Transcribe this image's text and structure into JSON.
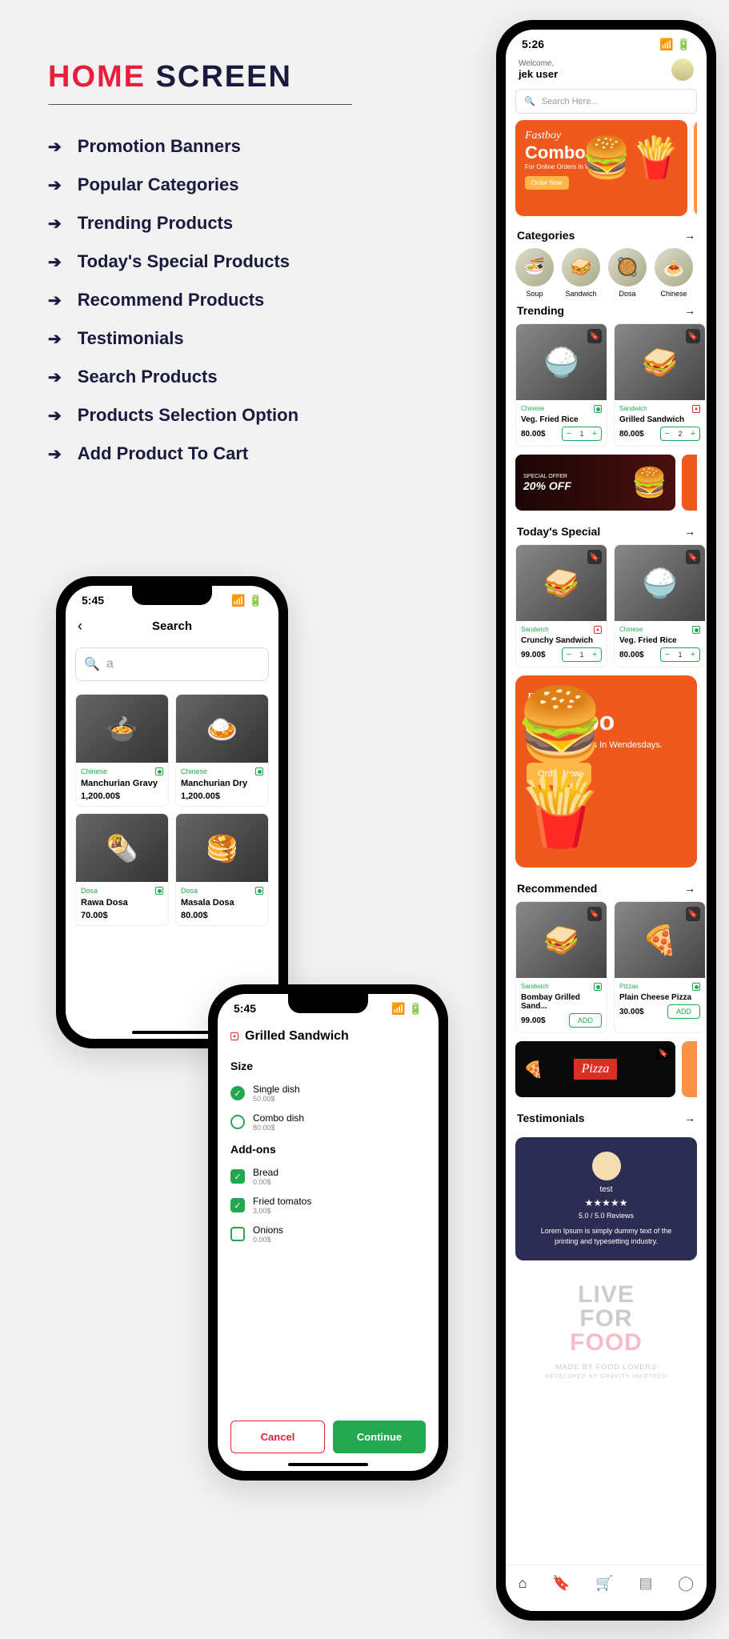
{
  "page": {
    "title_accent": "HOME",
    "title_rest": "SCREEN"
  },
  "features": [
    "Promotion Banners",
    "Popular Categories",
    "Trending Products",
    "Today's Special Products",
    "Recommend Products",
    "Testimonials",
    "Search Products",
    "Products Selection Option",
    "Add Product To Cart"
  ],
  "searchScreen": {
    "time": "5:45",
    "title": "Search",
    "query": "a",
    "products": [
      {
        "cat": "Chinese",
        "name": "Manchurian Gravy",
        "price": "1,200.00$",
        "emoji": "🍲"
      },
      {
        "cat": "Chinese",
        "name": "Manchurian Dry",
        "price": "1,200.00$",
        "emoji": "🍛"
      },
      {
        "cat": "Dosa",
        "name": "Rawa Dosa",
        "price": "70.00$",
        "emoji": "🌯"
      },
      {
        "cat": "Dosa",
        "name": "Masala Dosa",
        "price": "80.00$",
        "emoji": "🥞"
      }
    ]
  },
  "detailScreen": {
    "time": "5:45",
    "title": "Grilled Sandwich",
    "sizeLabel": "Size",
    "sizes": [
      {
        "name": "Single dish",
        "price": "50.00$",
        "selected": true
      },
      {
        "name": "Combo dish",
        "price": "80.00$",
        "selected": false
      }
    ],
    "addonsLabel": "Add-ons",
    "addons": [
      {
        "name": "Bread",
        "price": "0.00$",
        "selected": true
      },
      {
        "name": "Fried tomatos",
        "price": "3.00$",
        "selected": true
      },
      {
        "name": "Onions",
        "price": "0.00$",
        "selected": false
      }
    ],
    "cancel": "Cancel",
    "continue": "Continue"
  },
  "homeScreen": {
    "time": "5:26",
    "welcome": "Welcome,",
    "user": "jek user",
    "searchPlaceholder": "Search Here...",
    "promo": {
      "brand": "Fastboy",
      "combo": "Combo",
      "sub": "For Online Orders In Wendesdays.",
      "btn": "Order Now"
    },
    "catsTitle": "Categories",
    "cats": [
      {
        "name": "Soup",
        "emoji": "🍜"
      },
      {
        "name": "Sandwich",
        "emoji": "🥪"
      },
      {
        "name": "Dosa",
        "emoji": "🥘"
      },
      {
        "name": "Chinese",
        "emoji": "🍝"
      }
    ],
    "trendTitle": "Trending",
    "trending": [
      {
        "cat": "Chinese",
        "name": "Veg. Fried Rice",
        "price": "80.00$",
        "qty": "1",
        "veg": true,
        "emoji": "🍚"
      },
      {
        "cat": "Sandwich",
        "name": "Grilled Sandwich",
        "price": "80.00$",
        "qty": "2",
        "veg": false,
        "emoji": "🥪"
      }
    ],
    "discount": {
      "off": "20% OFF"
    },
    "specialTitle": "Today's Special",
    "special": [
      {
        "cat": "Sandwich",
        "name": "Crunchy Sandwich",
        "price": "99.00$",
        "qty": "1",
        "veg": false,
        "emoji": "🥪"
      },
      {
        "cat": "Chinese",
        "name": "Veg. Fried Rice",
        "price": "80.00$",
        "qty": "1",
        "veg": true,
        "emoji": "🍚"
      }
    ],
    "recTitle": "Recommended",
    "recommended": [
      {
        "cat": "Sandwich",
        "name": "Bombay Grilled Sand...",
        "price": "99.00$",
        "veg": true,
        "emoji": "🥪"
      },
      {
        "cat": "Pizzas",
        "name": "Plain Cheese Pizza",
        "price": "30.00$",
        "veg": true,
        "emoji": "🍕"
      }
    ],
    "addLabel": "ADD",
    "pizzaText": "Pizza",
    "testTitle": "Testimonials",
    "testimonial": {
      "name": "test",
      "stars": "★★★★★",
      "score": "5.0 / 5.0 Reviews",
      "text": "Lorem Ipsum is simply dummy text of the printing and typesetting industry."
    },
    "logo": {
      "l1": "LIVE",
      "l2": "FOR",
      "l3": "FOOD",
      "made": "MADE BY FOOD LOVERS",
      "dev": "DEVELOPED BY GRAVITY INFOTECH"
    }
  }
}
